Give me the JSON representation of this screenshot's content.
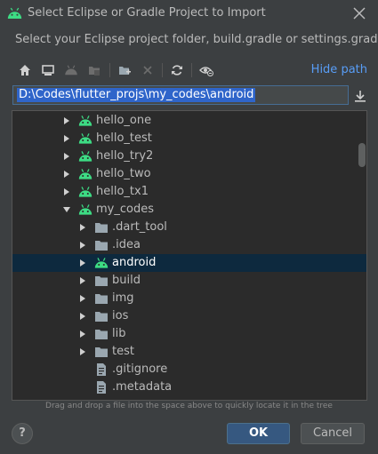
{
  "window": {
    "title": "Select Eclipse or Gradle Project to Import",
    "subtitle": "Select your Eclipse project folder, build.gradle or settings.gradle"
  },
  "toolbar": {
    "icons": [
      "home-icon",
      "desktop-icon",
      "android-icon",
      "folder-icon",
      "new-folder-icon",
      "delete-icon",
      "refresh-icon",
      "show-hidden-icon"
    ],
    "hide_path_label": "Hide path"
  },
  "path": {
    "value": "D:\\Codes\\flutter_projs\\my_codes\\android"
  },
  "tree": {
    "rows": [
      {
        "label": "hello_one",
        "icon": "android-icon",
        "expanded": false
      },
      {
        "label": "hello_test",
        "icon": "android-icon",
        "expanded": false
      },
      {
        "label": "hello_try2",
        "icon": "android-icon",
        "expanded": false
      },
      {
        "label": "hello_two",
        "icon": "android-icon",
        "expanded": false
      },
      {
        "label": "hello_tx1",
        "icon": "android-icon",
        "expanded": false
      },
      {
        "label": "my_codes",
        "icon": "android-icon",
        "expanded": true
      },
      {
        "label": ".dart_tool",
        "icon": "folder-icon",
        "expanded": false
      },
      {
        "label": ".idea",
        "icon": "folder-icon",
        "expanded": false
      },
      {
        "label": "android",
        "icon": "android-icon",
        "expanded": false,
        "selected": true
      },
      {
        "label": "build",
        "icon": "folder-icon",
        "expanded": false
      },
      {
        "label": "img",
        "icon": "folder-icon",
        "expanded": false
      },
      {
        "label": "ios",
        "icon": "folder-icon",
        "expanded": false
      },
      {
        "label": "lib",
        "icon": "folder-icon",
        "expanded": false
      },
      {
        "label": "test",
        "icon": "folder-icon",
        "expanded": false
      },
      {
        "label": ".gitignore",
        "icon": "file-icon"
      },
      {
        "label": ".metadata",
        "icon": "file-icon"
      }
    ]
  },
  "hint": "Drag and drop a file into the space above to quickly locate it in the tree",
  "buttons": {
    "help": "?",
    "ok": "OK",
    "cancel": "Cancel"
  },
  "colors": {
    "accent": "#589df6",
    "android_green": "#3ddc84",
    "selection": "#0d293e",
    "path_selection": "#2f65ca"
  }
}
